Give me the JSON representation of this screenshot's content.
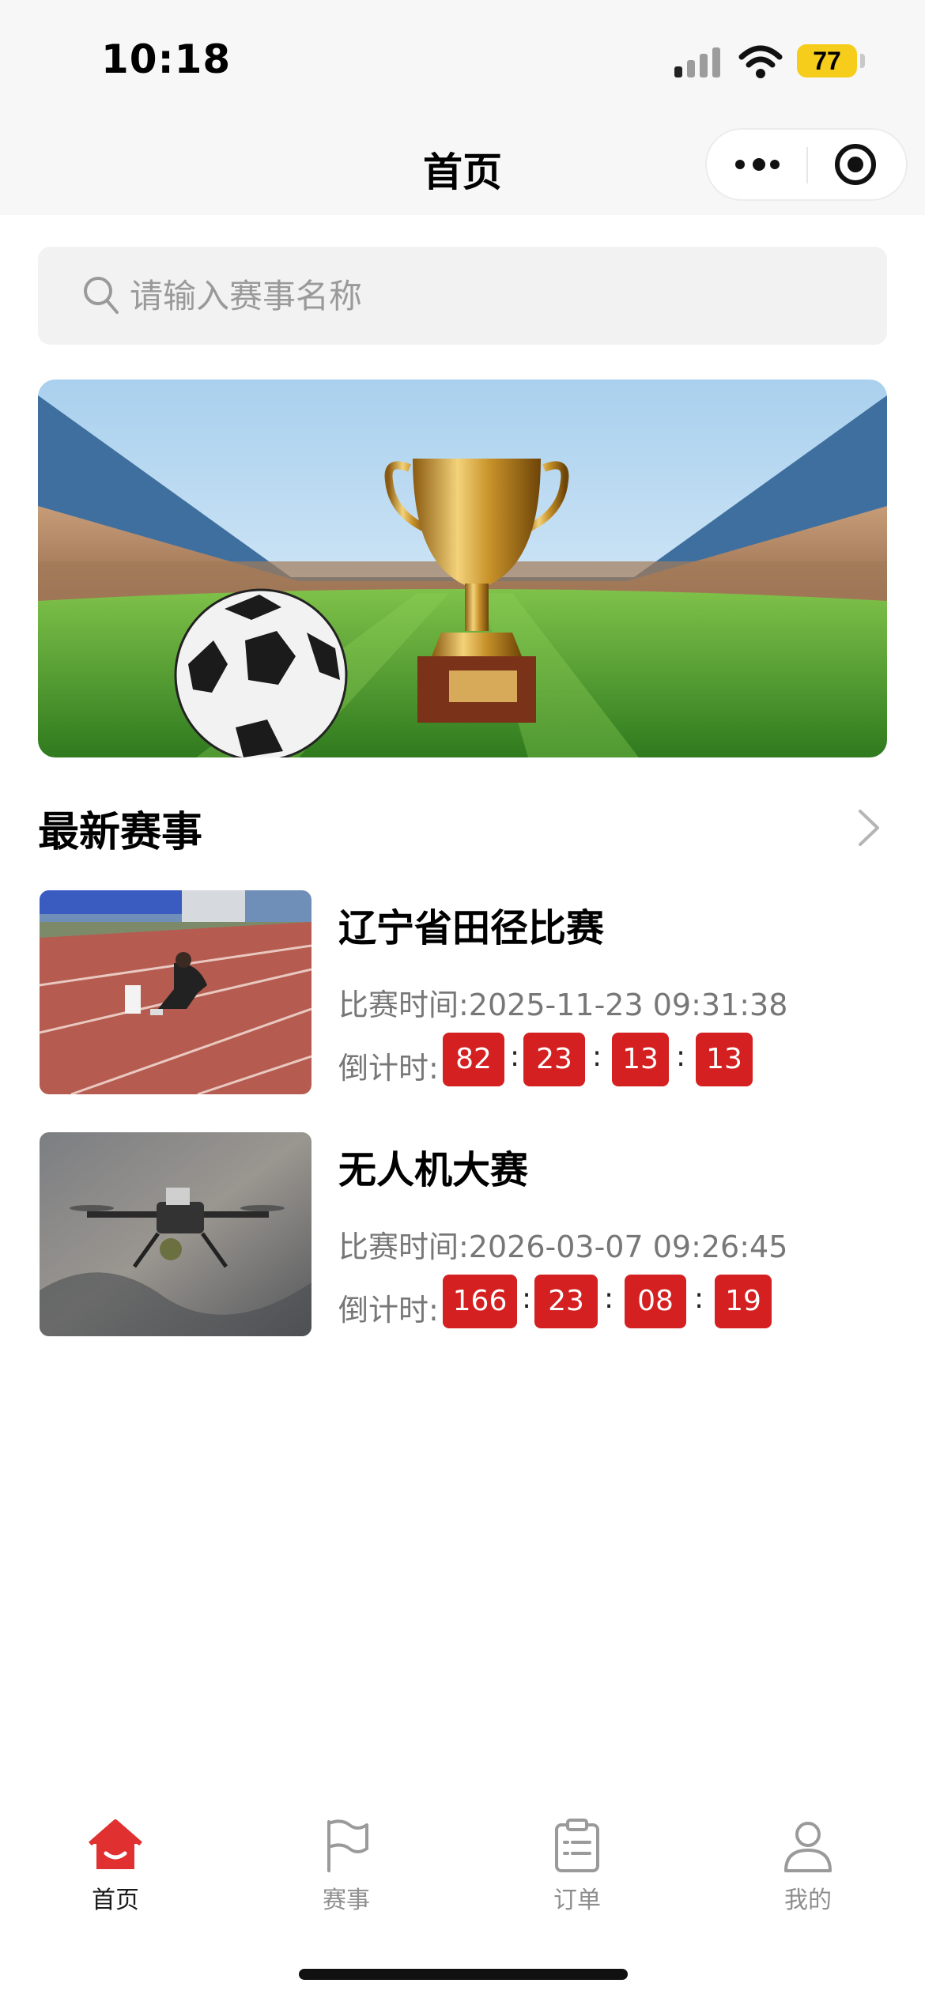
{
  "status_bar": {
    "time": "10:18",
    "battery": "77",
    "icons": [
      "signal-icon",
      "wifi-icon",
      "battery-icon"
    ]
  },
  "nav": {
    "title": "首页",
    "more_icon": "more-dots-icon",
    "target_icon": "target-circle-icon"
  },
  "search": {
    "placeholder": "请输入赛事名称",
    "icon": "search-icon"
  },
  "banner": {
    "image": "trophy-and-football-in-stadium"
  },
  "section": {
    "title": "最新赛事",
    "arrow_icon": "chevron-right-icon"
  },
  "events": [
    {
      "name": "辽宁省田径比赛",
      "time": "比赛时间:2025-11-23 09:31:38",
      "countdown_label": "倒计时:",
      "countdown": [
        "82",
        "23",
        "13",
        "13"
      ],
      "thumbnail": "track-sprinter-photo"
    },
    {
      "name": "无人机大赛",
      "time": "比赛时间:2026-03-07 09:26:45",
      "countdown_label": "倒计时:",
      "countdown": [
        "166",
        "23",
        "08",
        "19"
      ],
      "thumbnail": "drone-photo"
    }
  ],
  "colon": ":",
  "colors": {
    "accent_red": "#d42020",
    "tab_active": "#e03030",
    "tab_inactive": "#9a9a9a",
    "battery": "#f6cd1a"
  },
  "tabbar": {
    "items": [
      {
        "label": "首页",
        "icon": "home-icon",
        "active": true
      },
      {
        "label": "赛事",
        "icon": "flag-icon",
        "active": false
      },
      {
        "label": "订单",
        "icon": "clipboard-icon",
        "active": false
      },
      {
        "label": "我的",
        "icon": "user-icon",
        "active": false
      }
    ]
  }
}
